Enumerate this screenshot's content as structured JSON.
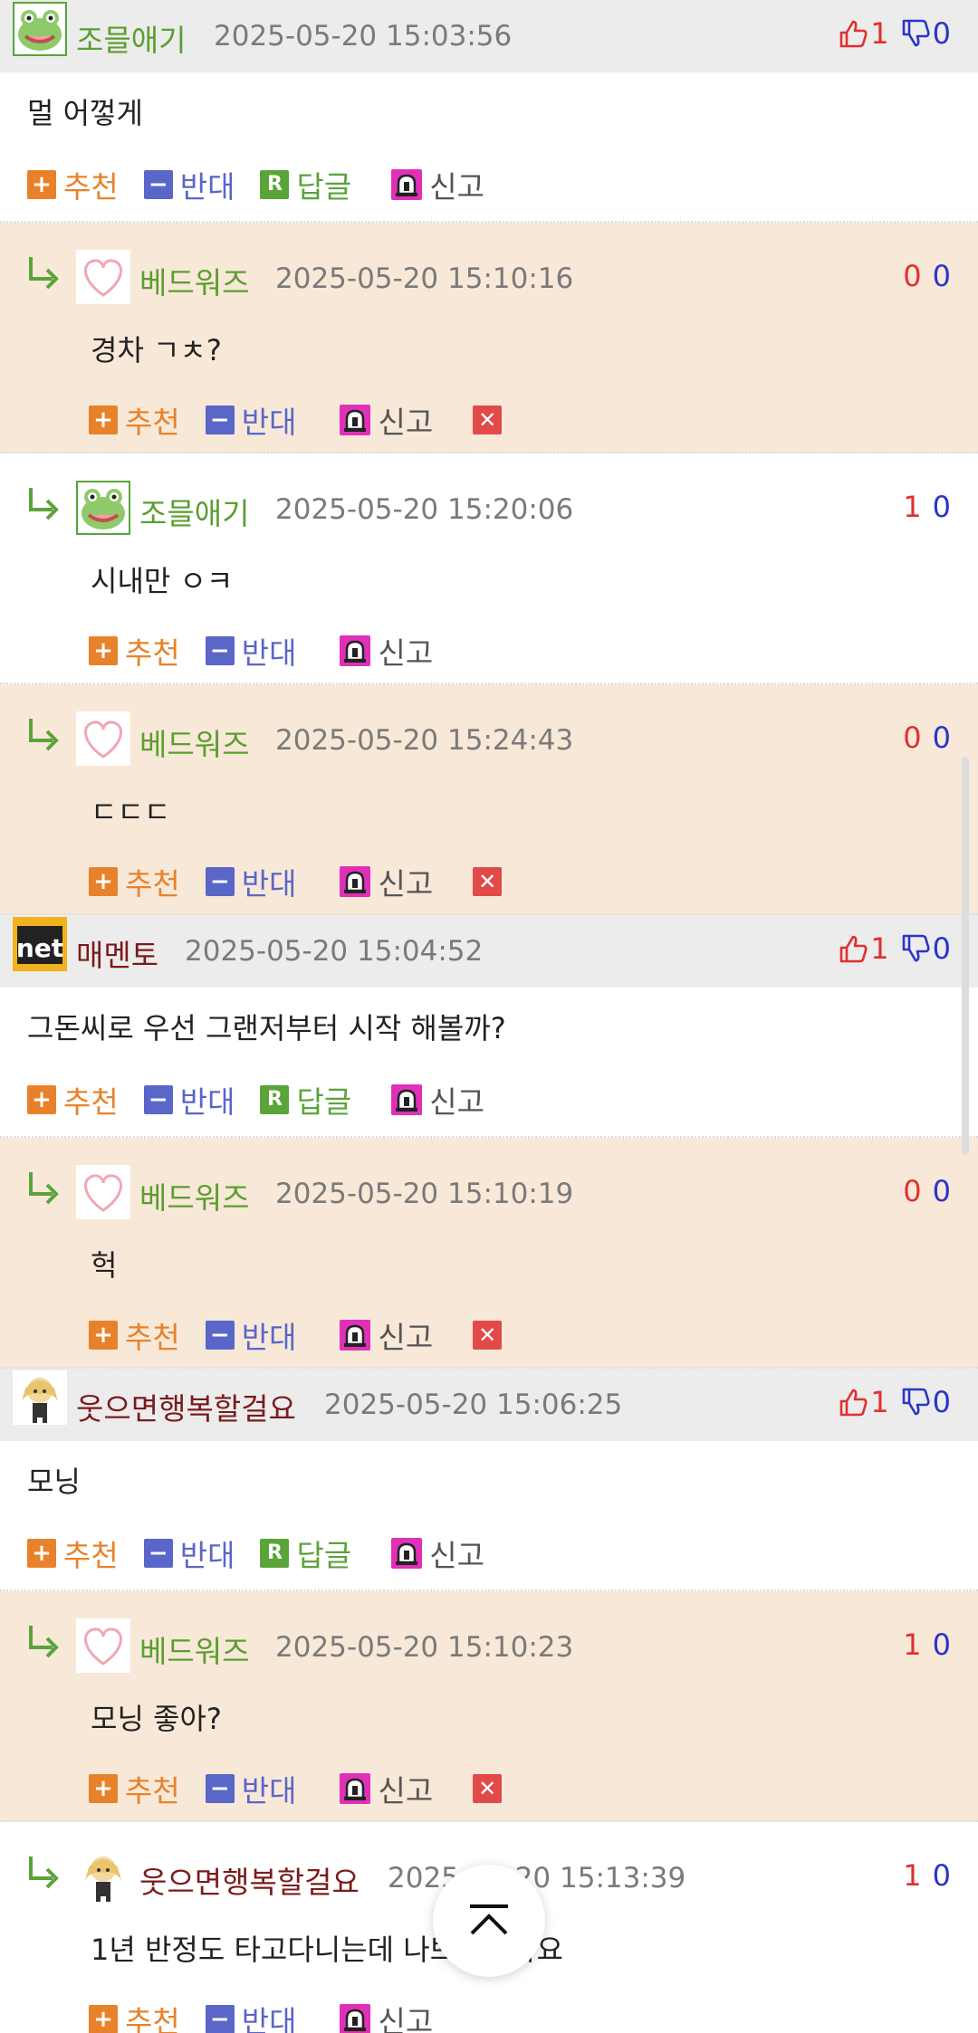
{
  "labels": {
    "recommend": "추천",
    "oppose": "반대",
    "reply": "답글",
    "report": "신고"
  },
  "icons": {
    "recommend": "plus-icon",
    "oppose": "minus-icon",
    "reply": "reply-r-icon",
    "report": "siren-icon",
    "delete": "close-icon",
    "reply_arrow": "reply-arrow-icon",
    "thumbs_up": "thumbs-up-icon",
    "thumbs_down": "thumbs-down-icon",
    "scroll_top": "chevron-up-icon"
  },
  "colors": {
    "accent_orange": "#e8822a",
    "accent_blue": "#5a66c8",
    "accent_green": "#5aa43a",
    "nick_green": "#5a9e2f",
    "nick_brown": "#7a1b1b",
    "reply_bg": "#f8e8d8",
    "vote_up": "#e0302e",
    "vote_down": "#2a35c9"
  },
  "comments": [
    {
      "nick": "조믈애기",
      "date": "2025-05-20 15:03:56",
      "up": "1",
      "down": "0",
      "text": "멀 어껗게"
    },
    {
      "nick": "베드워즈",
      "date": "2025-05-20 15:10:16",
      "up": "0",
      "down": "0",
      "text": "경차 ㄱㅊ?"
    },
    {
      "nick": "조믈애기",
      "date": "2025-05-20 15:20:06",
      "up": "1",
      "down": "0",
      "text": "시내만 ㅇㅋ"
    },
    {
      "nick": "베드워즈",
      "date": "2025-05-20 15:24:43",
      "up": "0",
      "down": "0",
      "text": "ㄷㄷㄷ"
    },
    {
      "nick": "매멘토",
      "date": "2025-05-20 15:04:52",
      "up": "1",
      "down": "0",
      "text": "그돈씨로 우선 그랜저부터 시작 해볼까?"
    },
    {
      "nick": "베드워즈",
      "date": "2025-05-20 15:10:19",
      "up": "0",
      "down": "0",
      "text": "헉"
    },
    {
      "nick": "웃으면행복할걸요",
      "date": "2025-05-20 15:06:25",
      "up": "1",
      "down": "0",
      "text": "모닝"
    },
    {
      "nick": "베드워즈",
      "date": "2025-05-20 15:10:23",
      "up": "1",
      "down": "0",
      "text": "모닝 좋아?"
    },
    {
      "nick": "웃으면행복할걸요",
      "date": "2025-05-20 15:13:39",
      "up": "1",
      "down": "0",
      "text": "1년 반정도 타고다니는데 나쁘지않아요"
    }
  ]
}
